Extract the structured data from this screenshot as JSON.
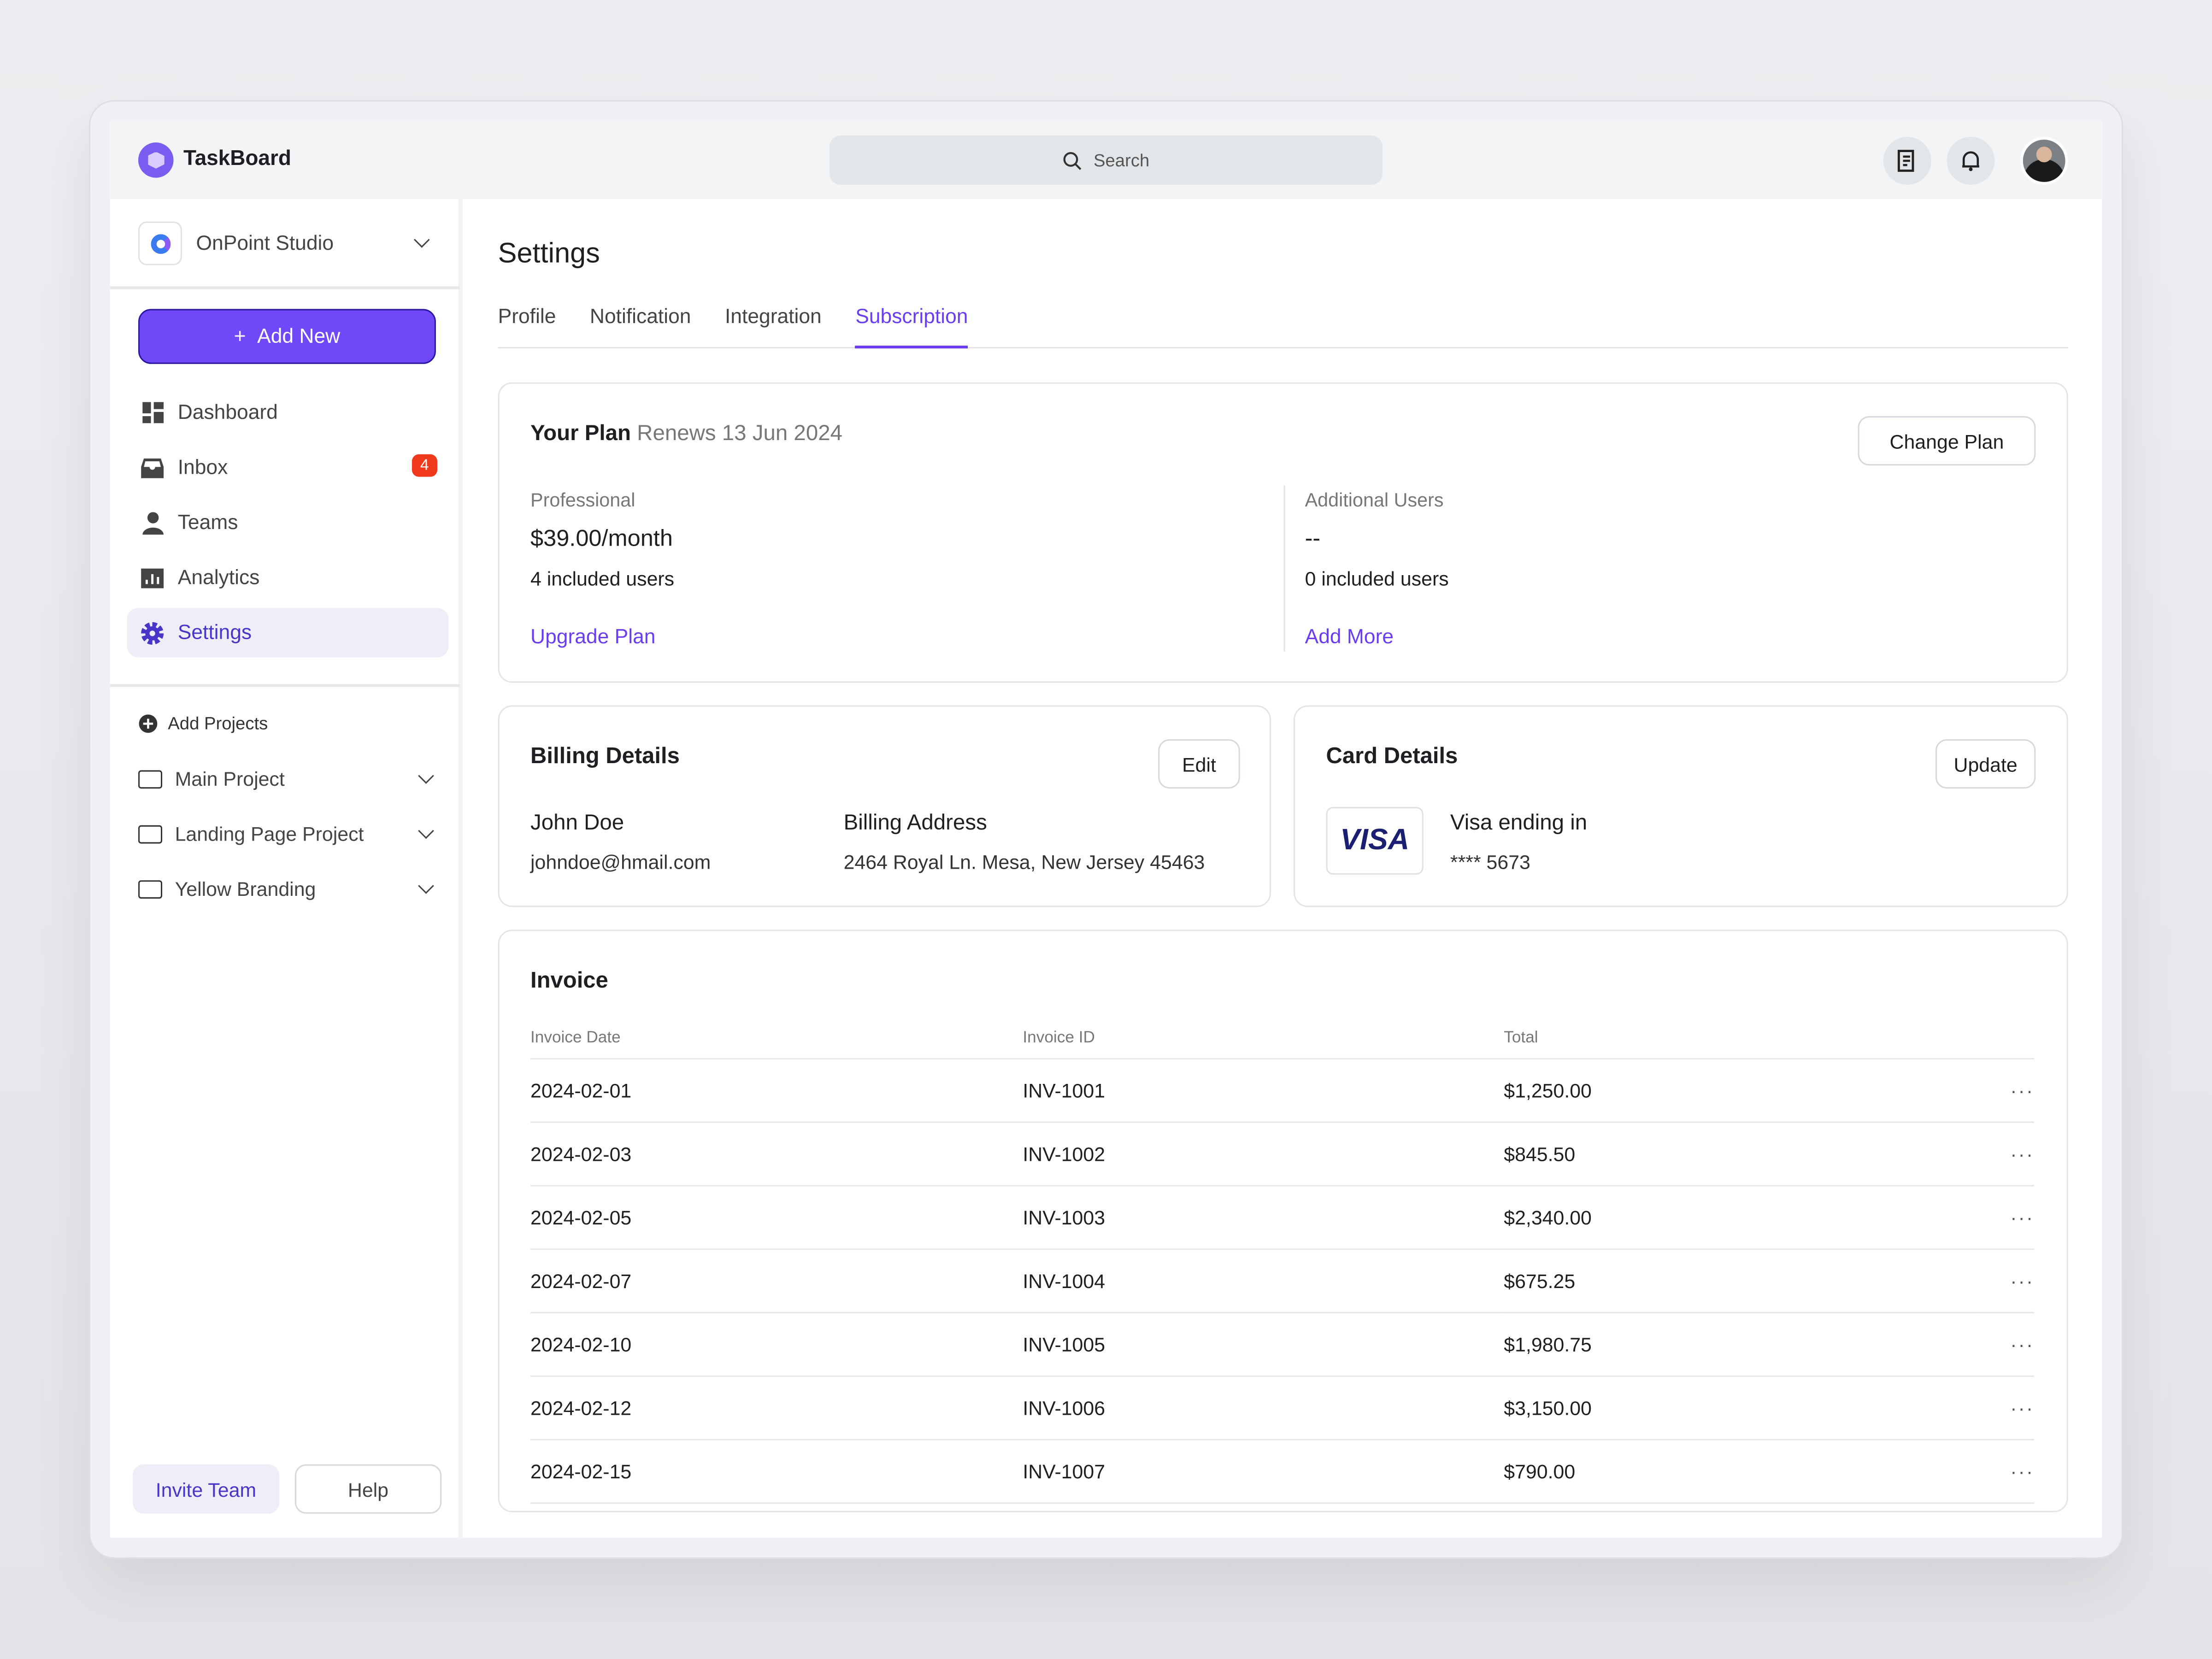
{
  "app": {
    "name": "TaskBoard",
    "search_placeholder": "Search"
  },
  "workspace": {
    "name": "OnPoint Studio"
  },
  "sidebar": {
    "add_new": "Add New",
    "items": [
      {
        "label": "Dashboard",
        "icon": "dashboard-icon"
      },
      {
        "label": "Inbox",
        "icon": "inbox-icon",
        "badge": "4"
      },
      {
        "label": "Teams",
        "icon": "user-icon"
      },
      {
        "label": "Analytics",
        "icon": "analytics-icon"
      },
      {
        "label": "Settings",
        "icon": "gear-icon",
        "active": true
      }
    ],
    "add_projects": "Add Projects",
    "projects": [
      "Main Project",
      "Landing Page Project",
      "Yellow Branding"
    ],
    "invite": "Invite Team",
    "help": "Help"
  },
  "page": {
    "title": "Settings",
    "tabs": [
      "Profile",
      "Notification",
      "Integration",
      "Subscription"
    ],
    "active_tab": "Subscription"
  },
  "plan": {
    "title": "Your Plan",
    "renews": "Renews 13 Jun 2024",
    "change": "Change Plan",
    "name": "Professional",
    "price": "$39.00/month",
    "users": "4 included users",
    "upgrade": "Upgrade Plan",
    "add_label": "Additional Users",
    "add_price": "--",
    "add_users": "0 included users",
    "add_more": "Add More"
  },
  "billing": {
    "title": "Billing Details",
    "edit": "Edit",
    "name": "John Doe",
    "email": "johndoe@hmail.com",
    "addr_label": "Billing Address",
    "address": "2464 Royal Ln. Mesa, New Jersey 45463"
  },
  "card": {
    "title": "Card Details",
    "update": "Update",
    "brand": "VISA",
    "label": "Visa ending in",
    "number": "**** 5673"
  },
  "invoice": {
    "title": "Invoice",
    "columns": [
      "Invoice Date",
      "Invoice ID",
      "Total"
    ],
    "rows": [
      [
        "2024-02-01",
        "INV-1001",
        "$1,250.00"
      ],
      [
        "2024-02-03",
        "INV-1002",
        "$845.50"
      ],
      [
        "2024-02-05",
        "INV-1003",
        "$2,340.00"
      ],
      [
        "2024-02-07",
        "INV-1004",
        "$675.25"
      ],
      [
        "2024-02-10",
        "INV-1005",
        "$1,980.75"
      ],
      [
        "2024-02-12",
        "INV-1006",
        "$3,150.00"
      ],
      [
        "2024-02-15",
        "INV-1007",
        "$790.00"
      ]
    ],
    "more": "···"
  },
  "colors": {
    "accent": "#7048f8",
    "badge": "#f0391a"
  }
}
